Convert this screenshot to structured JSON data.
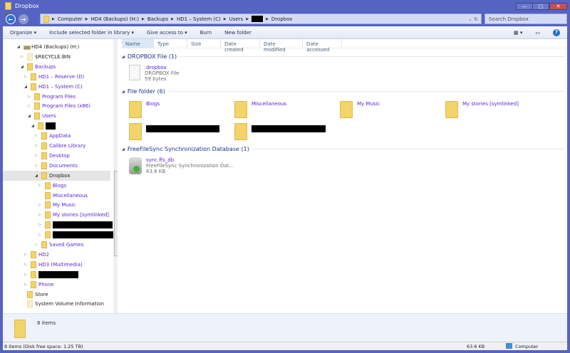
{
  "window": {
    "title": "Dropbox"
  },
  "address": {
    "crumbs": [
      "Computer",
      "HD4 (Backups) (H:)",
      "Backups",
      "HD1 – System (C)",
      "Users",
      "",
      "Dropbox"
    ],
    "search_placeholder": "Search Dropbox"
  },
  "toolbar": {
    "organize": "Organize ▾",
    "include": "Include selected folder in library ▾",
    "give_access": "Give access to ▾",
    "burn": "Burn",
    "new_folder": "New folder"
  },
  "columns": [
    "Name",
    "Type",
    "Size",
    "Date created",
    "Date modified",
    "Date accessed"
  ],
  "tree": [
    {
      "level": 0,
      "arrow": "open",
      "label": "HD4 (Backups) (H:)",
      "drive": true
    },
    {
      "level": 1,
      "arrow": "closed",
      "label": "$RECYCLE.BIN",
      "pale": true,
      "dark": true
    },
    {
      "level": 1,
      "arrow": "open",
      "label": "Backups"
    },
    {
      "level": 2,
      "arrow": "closed",
      "label": "HD1 – Reserve (D)"
    },
    {
      "level": 2,
      "arrow": "open",
      "label": "HD1 – System (C)"
    },
    {
      "level": 3,
      "arrow": "closed",
      "label": "Program Files"
    },
    {
      "level": 3,
      "arrow": "closed",
      "label": "Program Files (x86)"
    },
    {
      "level": 3,
      "arrow": "open",
      "label": "Users"
    },
    {
      "level": 4,
      "arrow": "open",
      "label": "",
      "redacted": 14
    },
    {
      "level": 5,
      "arrow": "closed",
      "label": "AppData"
    },
    {
      "level": 5,
      "arrow": "closed",
      "label": "Calibre Library"
    },
    {
      "level": 5,
      "arrow": "closed",
      "label": "Desktop"
    },
    {
      "level": 5,
      "arrow": "closed",
      "label": "Documents"
    },
    {
      "level": 5,
      "arrow": "open",
      "label": "Dropbox",
      "selected": true,
      "dark": true
    },
    {
      "level": 6,
      "arrow": "closed",
      "label": "Blogs"
    },
    {
      "level": 6,
      "arrow": "none",
      "label": "Miscellaneous"
    },
    {
      "level": 6,
      "arrow": "closed",
      "label": "My Music"
    },
    {
      "level": 6,
      "arrow": "closed",
      "label": "My stories [symlinked]"
    },
    {
      "level": 6,
      "arrow": "closed",
      "label": "",
      "redacted": 84
    },
    {
      "level": 6,
      "arrow": "closed",
      "label": "",
      "redacted": 88
    },
    {
      "level": 5,
      "arrow": "closed",
      "label": "Saved Games"
    },
    {
      "level": 2,
      "arrow": "closed",
      "label": "HD2"
    },
    {
      "level": 2,
      "arrow": "closed",
      "label": "HD3 (Multimedia)"
    },
    {
      "level": 2,
      "arrow": "closed",
      "label": "",
      "redacted": 56
    },
    {
      "level": 2,
      "arrow": "closed",
      "label": "Phone"
    },
    {
      "level": 1,
      "arrow": "none",
      "label": "Store",
      "dark": true
    },
    {
      "level": 1,
      "arrow": "none",
      "label": "System Volume Information",
      "pale": true,
      "dark": true
    }
  ],
  "groups": {
    "dropbox_file": {
      "title": "DROPBOX File (1)",
      "item": {
        "name": ".dropbox",
        "type": "DROPBOX File",
        "size": "59 bytes"
      }
    },
    "file_folder": {
      "title": "File folder (6)",
      "items": [
        "Blogs",
        "Miscellaneous",
        "My Music",
        "My stories [symlinked]"
      ]
    },
    "ffs": {
      "title": "FreeFileSync Synchronization Database (1)",
      "item": {
        "name": "sync.ffs_db",
        "type": "FreeFileSync Synchronization Dat...",
        "size": "63.6 KB"
      }
    }
  },
  "details": {
    "count": "8 items"
  },
  "status": {
    "left": "8 items (Disk free space: 1.25 TB)",
    "size": "63.6 KB",
    "location": "Computer"
  }
}
